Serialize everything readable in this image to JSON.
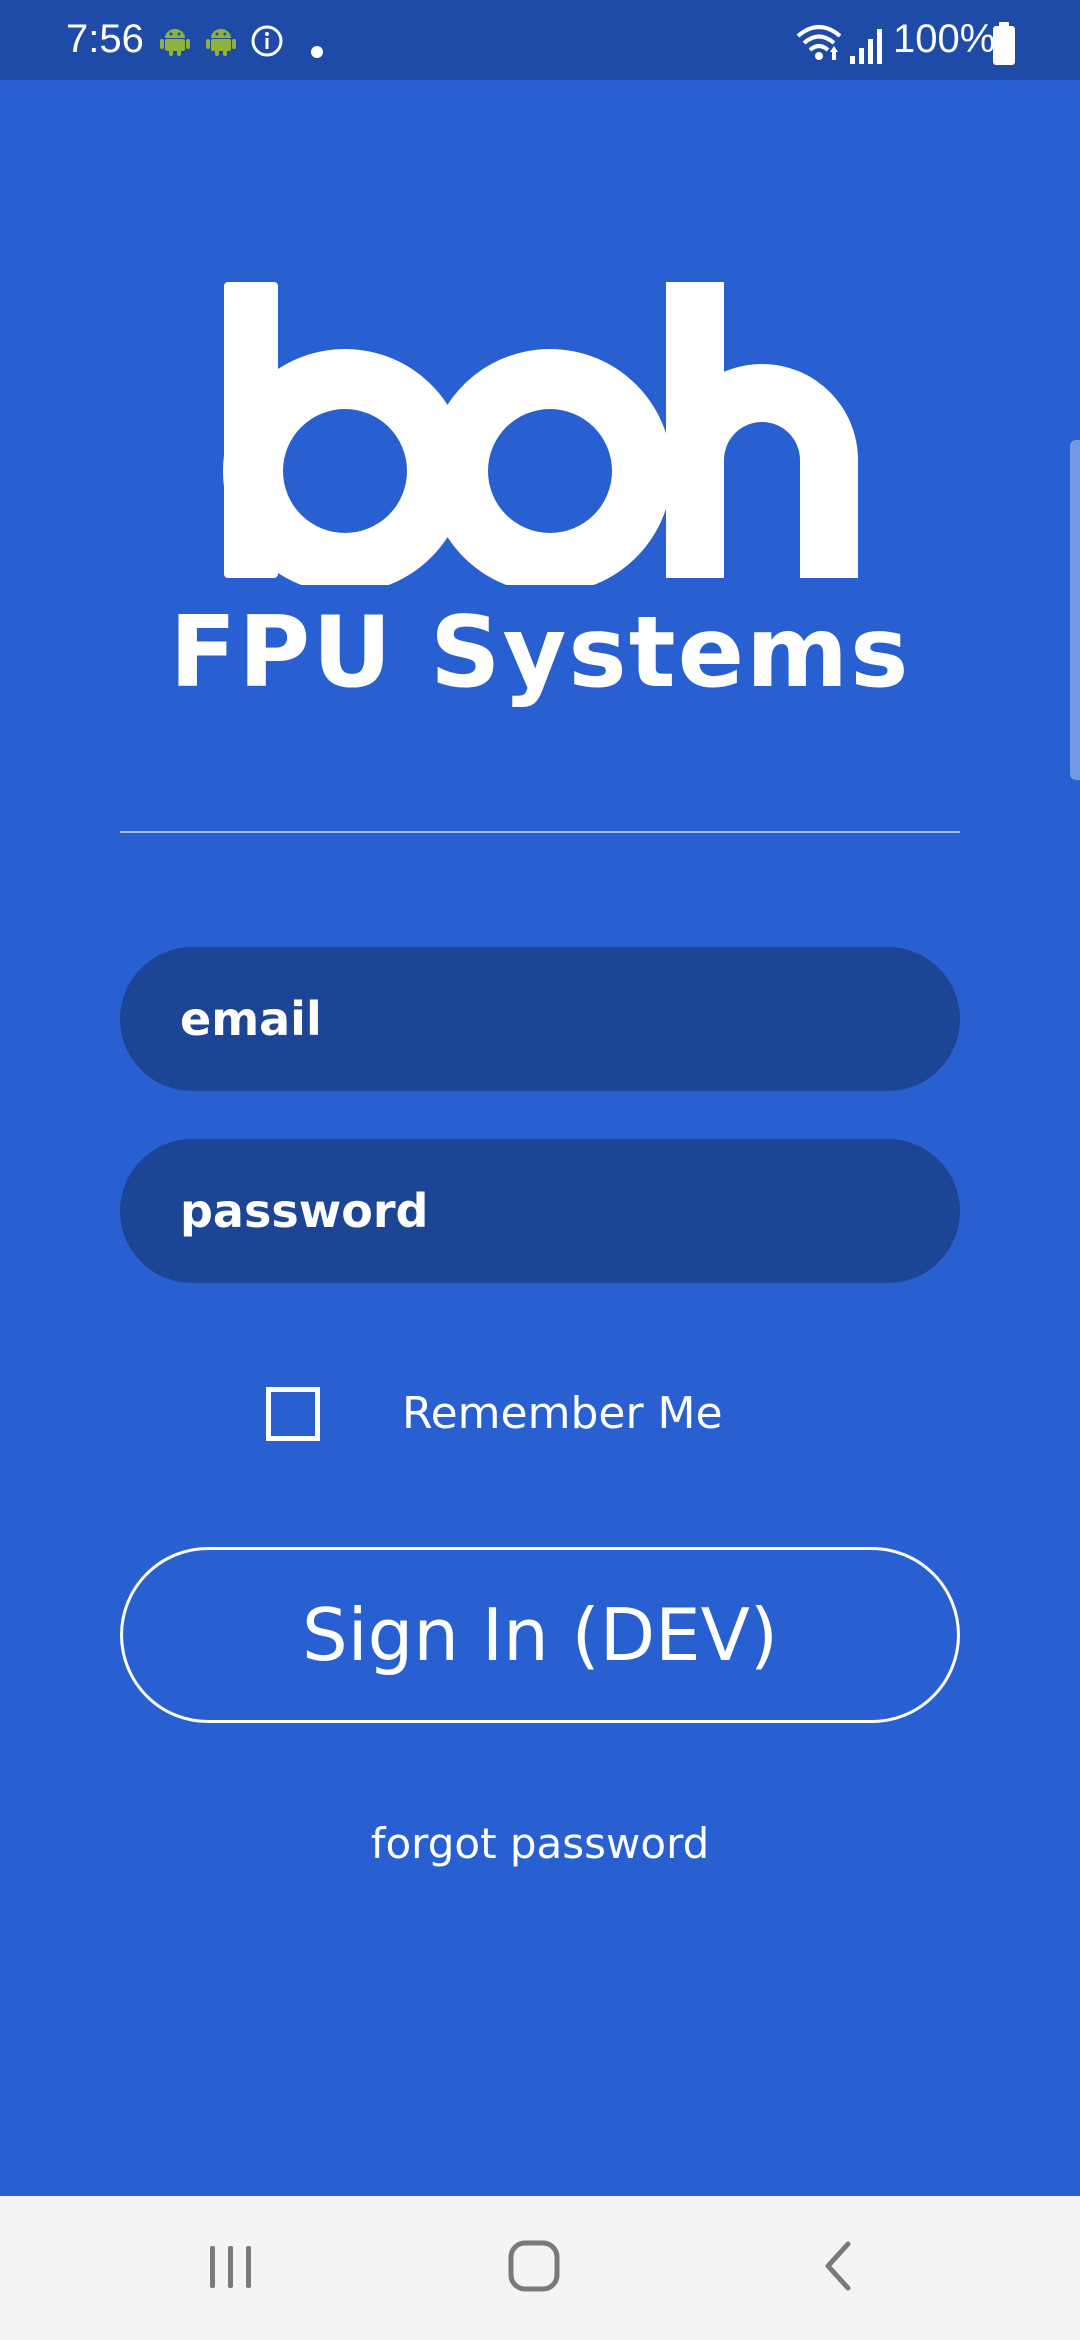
{
  "status_bar": {
    "time": "7:56",
    "icons": [
      "android-icon",
      "android-icon",
      "info-icon",
      "notification-dot",
      "wifi-icon",
      "signal-icon",
      "battery-icon"
    ],
    "battery": "100%"
  },
  "brand": {
    "logo_text": "boh",
    "subtitle": "FPU Systems"
  },
  "login_form": {
    "email_placeholder": "email",
    "password_placeholder": "password",
    "remember_label": "Remember Me",
    "remember_checked": false,
    "sign_in_label": "Sign In (DEV)",
    "forgot_label": "forgot password"
  },
  "nav_bar": {
    "buttons": [
      "recent-apps-icon",
      "home-icon",
      "back-icon"
    ]
  },
  "colors": {
    "background": "#2860d2",
    "status_bar": "#1e4aa8",
    "input_fill": "#1c4596",
    "text": "#ffffff",
    "nav_bar": "#f4f4f4"
  }
}
